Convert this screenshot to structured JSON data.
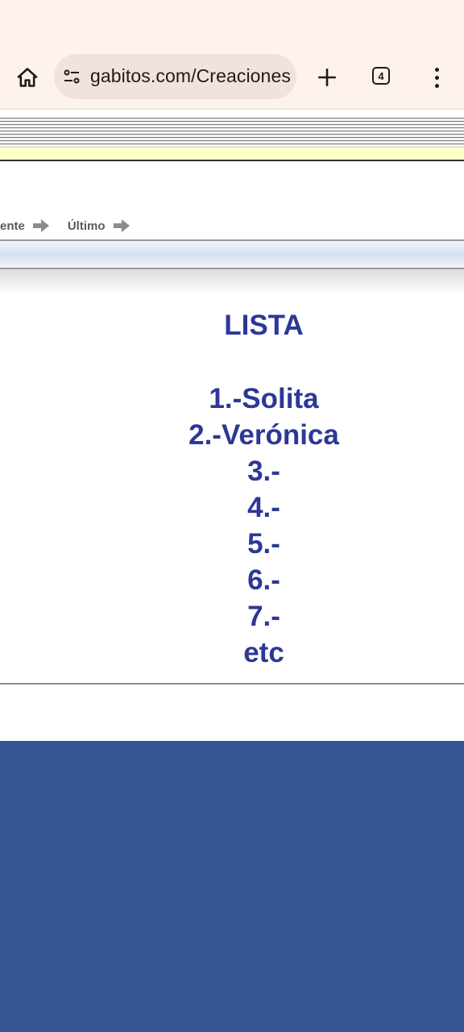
{
  "browser": {
    "url": "gabitos.com/Creaciones",
    "tab_count": "4",
    "icons": {
      "home": "home-icon",
      "site_info": "tune-icon",
      "new_tab": "plus-icon",
      "menu": "more-vert-icon"
    }
  },
  "page": {
    "nav": {
      "prev_partial": "ente",
      "last": "Último"
    },
    "title": "LISTA",
    "items": [
      "1.-Solita",
      "2.-Verónica",
      "3.-",
      "4.-",
      "5.-",
      "6.-",
      "7.-",
      "etc"
    ]
  },
  "colors": {
    "chrome_bg": "#fdf3ec",
    "text_blue": "#2c3896",
    "footer_blue": "#345591",
    "yellow": "#ffffc8"
  }
}
